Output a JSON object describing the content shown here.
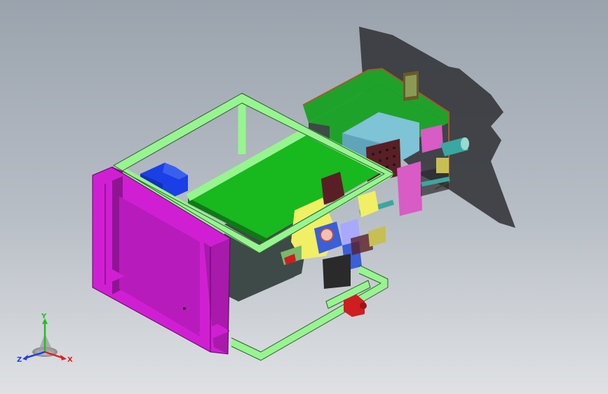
{
  "viewport": {
    "background_top": "#9aa3ad",
    "background_bottom": "#dfe1e4"
  },
  "colors": {
    "frame_green": "#97f58f",
    "frame_outline": "#2f5f2f",
    "magenta": "#d01fd3",
    "magenta_dark": "#8e1592",
    "deck_green": "#18b81f",
    "deck_green_dark": "#0f7a14",
    "mold_green": "#1fa22a",
    "cyan_block": "#7ec3d6",
    "blue_motor": "#1b3fe6",
    "brown_block": "#5a1f25",
    "yellow_plate": "#f1ef63",
    "pink_part": "#d85bc6",
    "shadow": "#2e2f33",
    "cylinder": "#3aa7a1",
    "red_part": "#cf1d20",
    "brown_outline": "#a35a2a",
    "dark_body": "#3d4a47"
  },
  "triad": {
    "icon": "coordinate-triad-icon",
    "x_label": "X",
    "y_label": "Y",
    "z_label": "Z",
    "x_color": "#e02020",
    "y_color": "#20c020",
    "z_color": "#2040e0"
  }
}
